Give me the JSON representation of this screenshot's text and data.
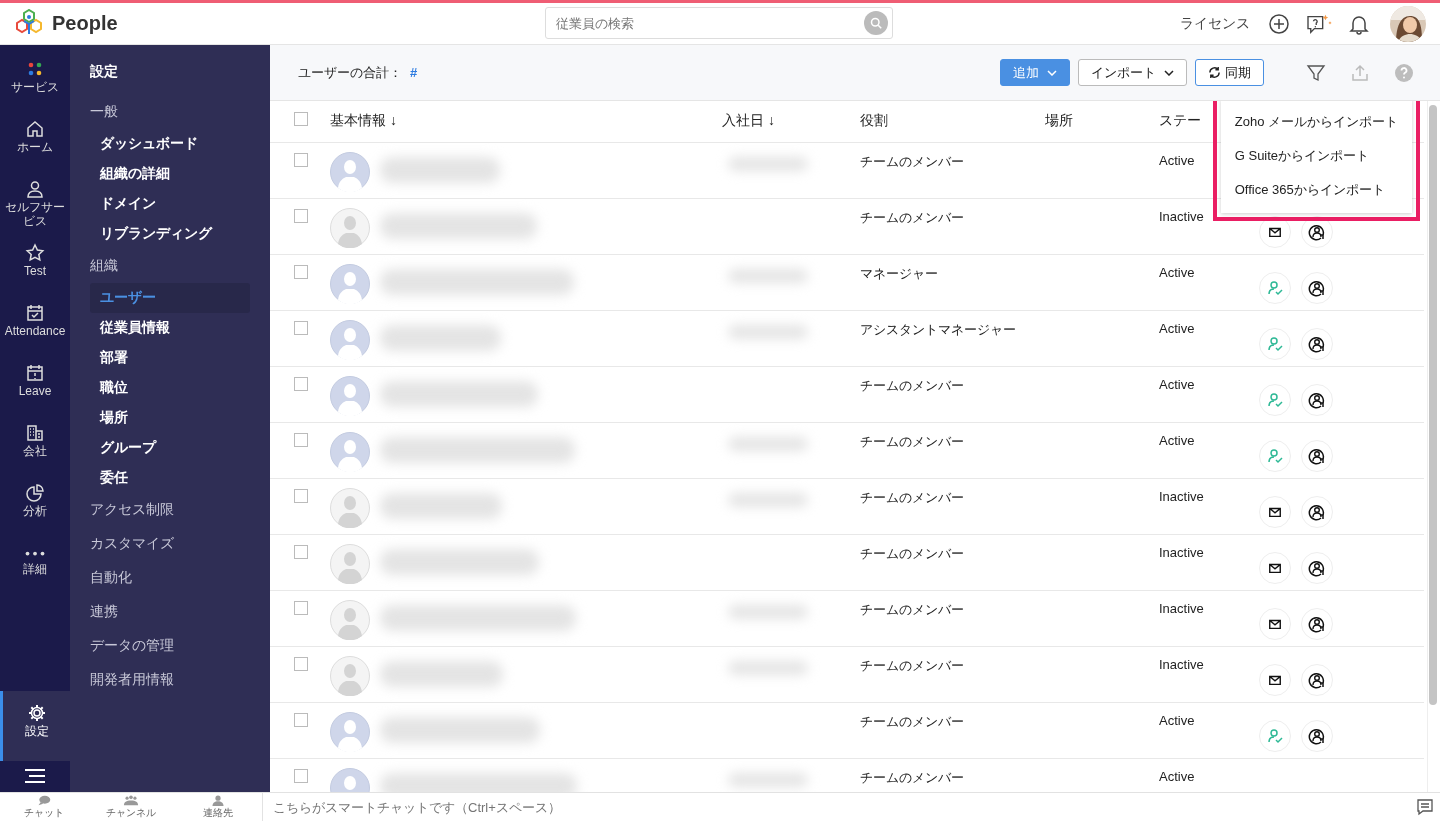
{
  "app": {
    "name": "People"
  },
  "search": {
    "placeholder": "従業員の検索"
  },
  "header": {
    "license": "ライセンス"
  },
  "rail": [
    {
      "label": "サービス"
    },
    {
      "label": "ホーム"
    },
    {
      "label": "セルフサービス"
    },
    {
      "label": "Test"
    },
    {
      "label": "Attendance"
    },
    {
      "label": "Leave"
    },
    {
      "label": "会社"
    },
    {
      "label": "分析"
    },
    {
      "label": "詳細"
    }
  ],
  "rail_bottom": {
    "label": "設定",
    "selected": true
  },
  "settings_menu": {
    "title": "設定",
    "items": [
      {
        "label": "一般",
        "children": [
          {
            "label": "ダッシュボード",
            "selected": false
          },
          {
            "label": "組織の詳細",
            "selected": false
          },
          {
            "label": "ドメイン",
            "selected": false
          },
          {
            "label": "リブランディング",
            "selected": false
          }
        ]
      },
      {
        "label": "組織",
        "children": [
          {
            "label": "ユーザー",
            "selected": true
          },
          {
            "label": "従業員情報",
            "selected": false
          },
          {
            "label": "部署",
            "selected": false
          },
          {
            "label": "職位",
            "selected": false
          },
          {
            "label": "場所",
            "selected": false
          },
          {
            "label": "グループ",
            "selected": false
          },
          {
            "label": "委任",
            "selected": false
          }
        ]
      },
      {
        "label": "アクセス制限"
      },
      {
        "label": "カスタマイズ"
      },
      {
        "label": "自動化"
      },
      {
        "label": "連携"
      },
      {
        "label": "データの管理"
      },
      {
        "label": "開発者用情報"
      }
    ]
  },
  "toolbar": {
    "total_label": "ユーザーの合計：",
    "total_value": "#",
    "add": "追加",
    "import": "インポート",
    "sync": "同期"
  },
  "import_menu": [
    "Zoho メールからインポート",
    "G Suiteからインポート",
    "Office 365からインポート"
  ],
  "table": {
    "columns": [
      "基本情報 ↓",
      "入社日 ↓",
      "役割",
      "場所",
      "ステー"
    ],
    "all_checked": false,
    "rows": [
      {
        "checked": false,
        "role": "チームのメンバー",
        "status": "Active",
        "active": true,
        "actions_shown": false
      },
      {
        "checked": false,
        "role": "チームのメンバー",
        "status": "Inactive",
        "active": false,
        "actions_shown": true
      },
      {
        "checked": false,
        "role": "マネージャー",
        "status": "Active",
        "active": true,
        "actions_shown": true
      },
      {
        "checked": false,
        "role": "アシスタントマネージャー",
        "status": "Active",
        "active": true,
        "actions_shown": true
      },
      {
        "checked": false,
        "role": "チームのメンバー",
        "status": "Active",
        "active": true,
        "actions_shown": true
      },
      {
        "checked": false,
        "role": "チームのメンバー",
        "status": "Active",
        "active": true,
        "actions_shown": true
      },
      {
        "checked": false,
        "role": "チームのメンバー",
        "status": "Inactive",
        "active": false,
        "actions_shown": true
      },
      {
        "checked": false,
        "role": "チームのメンバー",
        "status": "Inactive",
        "active": false,
        "actions_shown": true
      },
      {
        "checked": false,
        "role": "チームのメンバー",
        "status": "Inactive",
        "active": false,
        "actions_shown": true
      },
      {
        "checked": false,
        "role": "チームのメンバー",
        "status": "Inactive",
        "active": false,
        "actions_shown": true
      },
      {
        "checked": false,
        "role": "チームのメンバー",
        "status": "Active",
        "active": true,
        "actions_shown": true
      },
      {
        "checked": false,
        "role": "チームのメンバー",
        "status": "Active",
        "active": true,
        "actions_shown": false
      }
    ]
  },
  "bottom_bar": {
    "tabs": [
      "チャット",
      "チャンネル",
      "連絡先"
    ],
    "chat_placeholder": "こちらがスマートチャットです（Ctrl+スペース）"
  }
}
